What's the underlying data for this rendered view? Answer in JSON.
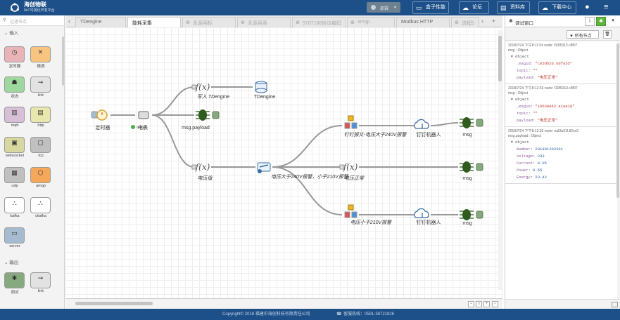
{
  "header": {
    "brand_title": "海创物联",
    "brand_subtitle": "IIoT可视化开发平台",
    "user": "邵霖",
    "buttons": [
      {
        "label": "盒子性能",
        "icon": "monitor-icon"
      },
      {
        "label": "论坛",
        "icon": "cloud-icon"
      },
      {
        "label": "资料库",
        "icon": "book-icon"
      },
      {
        "label": "下载中心",
        "icon": "cloud-download-icon"
      }
    ]
  },
  "palette": {
    "filter_placeholder": "过滤节点",
    "section_input": "输入",
    "section_output": "输出",
    "input_nodes": [
      {
        "label": "定时器",
        "color": "#e8b4b8",
        "glyph": "◷"
      },
      {
        "label": "微调",
        "color": "#f8c480",
        "glyph": "✕"
      },
      {
        "label": "状态",
        "color": "#9fd89f",
        "glyph": "☗"
      },
      {
        "label": "link",
        "color": "#e2e2e2",
        "glyph": "⇝"
      },
      {
        "label": "mqtt",
        "color": "#d8bfd8",
        "glyph": "▥"
      },
      {
        "label": "http",
        "color": "#e7e7ae",
        "glyph": "▤"
      },
      {
        "label": "websocket",
        "color": "#d7d7a0",
        "glyph": "▣"
      },
      {
        "label": "tcp",
        "color": "#c0c0c0",
        "glyph": "▢"
      },
      {
        "label": "udp",
        "color": "#c0c0c0",
        "glyph": "▦"
      },
      {
        "label": "amqp",
        "color": "#f6a85a",
        "glyph": "⬡"
      },
      {
        "label": "kafka",
        "color": "#ffffff",
        "glyph": "⛬"
      },
      {
        "label": "ckafka",
        "color": "#ffffff",
        "glyph": "⛬"
      },
      {
        "label": "server",
        "color": "#a6bbcf",
        "glyph": "▭"
      }
    ],
    "output_nodes": [
      {
        "label": "调试",
        "color": "#87a980",
        "glyph": "✱"
      },
      {
        "label": "link",
        "color": "#e2e2e2",
        "glyph": "⇝"
      }
    ]
  },
  "tabs": [
    {
      "label": "TDengine",
      "state": "normal"
    },
    {
      "label": "能耗采集",
      "state": "active"
    },
    {
      "label": "永源用标",
      "state": "dis"
    },
    {
      "label": "永源用表",
      "state": "dis"
    },
    {
      "label": "9707188协议编码",
      "state": "dis"
    },
    {
      "label": "amqp",
      "state": "dis"
    },
    {
      "label": "Modbus HTTP",
      "state": "normal"
    },
    {
      "label": "流程5",
      "state": "dis"
    }
  ],
  "flow": {
    "nodes": [
      {
        "id": "timer",
        "label": "定时器",
        "kind": "inject"
      },
      {
        "id": "meter",
        "label": "电表",
        "kind": "meter",
        "status": "active"
      },
      {
        "id": "fn_td",
        "label": "写入 TDengine",
        "kind": "function"
      },
      {
        "id": "tdengine",
        "label": "TDengine",
        "kind": "db"
      },
      {
        "id": "debug1",
        "label": "msg.payload",
        "kind": "debug"
      },
      {
        "id": "fn_volt",
        "label": "电压值",
        "kind": "function"
      },
      {
        "id": "switch",
        "label": "电压大于240V报警，小于210V报警",
        "kind": "switch"
      },
      {
        "id": "dd_high",
        "label": "钉钉报文-电压大于240V报警",
        "kind": "dingmsg"
      },
      {
        "id": "bot1",
        "label": "钉钉机器人",
        "kind": "cloud"
      },
      {
        "id": "debug2",
        "label": "msg",
        "kind": "debug"
      },
      {
        "id": "fn_normal",
        "label": "电压正常",
        "kind": "function"
      },
      {
        "id": "debug3",
        "label": "msg",
        "kind": "debug"
      },
      {
        "id": "dd_low",
        "label": "电压小于210V报警",
        "kind": "dingmsg"
      },
      {
        "id": "bot2",
        "label": "钉钉机器人",
        "kind": "cloud"
      },
      {
        "id": "debug4",
        "label": "msg",
        "kind": "debug"
      }
    ],
    "links": [
      [
        "timer",
        "meter"
      ],
      [
        "meter",
        "fn_td"
      ],
      [
        "meter",
        "debug1"
      ],
      [
        "meter",
        "fn_volt"
      ],
      [
        "fn_td",
        "tdengine"
      ],
      [
        "fn_volt",
        "switch"
      ],
      [
        "switch",
        "dd_high"
      ],
      [
        "switch",
        "fn_normal"
      ],
      [
        "switch",
        "dd_low"
      ],
      [
        "dd_high",
        "bot1"
      ],
      [
        "bot1",
        "debug2"
      ],
      [
        "fn_normal",
        "debug3"
      ],
      [
        "dd_low",
        "bot2"
      ],
      [
        "bot2",
        "debug4"
      ]
    ]
  },
  "sidebar": {
    "title": "调试窗口",
    "filter_all": "所有节点",
    "messages": [
      {
        "meta1": "2018/7/24 下午8:11:54   node: f10f5313.c8f07",
        "meta2": "msg : Object",
        "rows": [
          {
            "k": "_msgid",
            "v": "\"ce5db26.6dfa55\"",
            "t": "s"
          },
          {
            "k": "topic",
            "v": "\"\"",
            "t": "s"
          },
          {
            "k": "payload",
            "v": "\"电压正常\"",
            "t": "s"
          }
        ]
      },
      {
        "meta1": "2018/7/24 下午8:12:33   node: f10f5313.c8f07",
        "meta2": "msg : Object",
        "rows": [
          {
            "k": "_msgid",
            "v": "\"10630862.a1ae18\"",
            "t": "s"
          },
          {
            "k": "topic",
            "v": "\"\"",
            "t": "s"
          },
          {
            "k": "payload",
            "v": "\"电压正常\"",
            "t": "s"
          }
        ]
      },
      {
        "meta1": "2018/7/24 下午8:12:33   node: ea5fa31f.82ec5",
        "meta2": "msg.payload : Object",
        "rows": [
          {
            "k": "Number",
            "v": "201801202301",
            "t": "n"
          },
          {
            "k": "Voltage",
            "v": "233",
            "t": "n"
          },
          {
            "k": "Current",
            "v": "0.05",
            "t": "n"
          },
          {
            "k": "Power",
            "v": "0.55",
            "t": "n"
          },
          {
            "k": "Energy",
            "v": "23.42",
            "t": "n"
          }
        ]
      }
    ]
  },
  "footer": {
    "copyright": "Copyright© 2018 福建中海创科技有限责任公司",
    "hotline": "客服热线：0591-38721826"
  }
}
